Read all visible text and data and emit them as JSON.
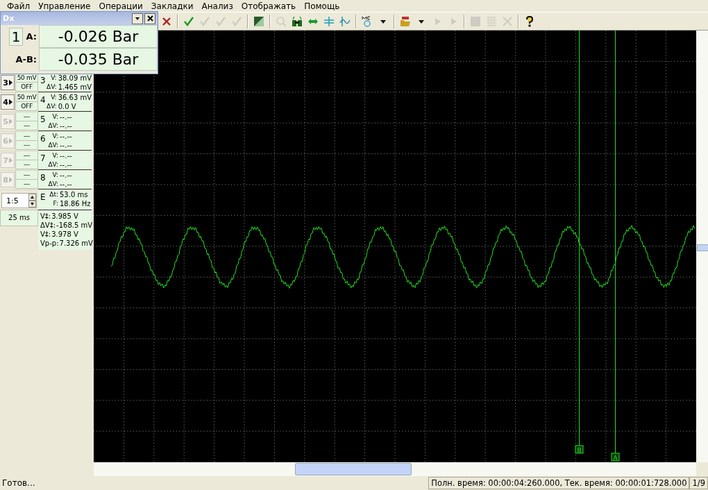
{
  "menu": [
    "Файл",
    "Управление",
    "Операции",
    "Закладки",
    "Анализ",
    "Отображать",
    "Помощь"
  ],
  "toolbar": [
    {
      "kind": "cross",
      "disabled": false
    },
    {
      "kind": "sep"
    },
    {
      "kind": "check",
      "disabled": false
    },
    {
      "kind": "check",
      "disabled": true
    },
    {
      "kind": "check",
      "disabled": true
    },
    {
      "kind": "check",
      "disabled": true
    },
    {
      "kind": "sep"
    },
    {
      "kind": "contrast",
      "disabled": false
    },
    {
      "kind": "sep"
    },
    {
      "kind": "magnifier",
      "disabled": true
    },
    {
      "kind": "binoculars",
      "disabled": false
    },
    {
      "kind": "arrows",
      "disabled": false
    },
    {
      "kind": "cursor",
      "disabled": false
    },
    {
      "kind": "wave",
      "disabled": false
    },
    {
      "kind": "sep"
    },
    {
      "kind": "mem",
      "disabled": false
    },
    {
      "kind": "dropdown",
      "disabled": false
    },
    {
      "kind": "sep"
    },
    {
      "kind": "folder",
      "disabled": false
    },
    {
      "kind": "dropdown",
      "disabled": false
    },
    {
      "kind": "play",
      "disabled": true
    },
    {
      "kind": "play",
      "disabled": true
    },
    {
      "kind": "sep"
    },
    {
      "kind": "square",
      "disabled": true
    },
    {
      "kind": "grid",
      "disabled": true
    },
    {
      "kind": "scissors",
      "disabled": true
    },
    {
      "kind": "sep"
    },
    {
      "kind": "help",
      "disabled": false
    }
  ],
  "dx_window": {
    "title": "Dx",
    "channel": "1",
    "rows": [
      {
        "label": "A:",
        "value": "-0.026 Bar"
      },
      {
        "label": "A-B:",
        "value": "-0.035 Bar"
      }
    ]
  },
  "channels": [
    {
      "button": "3",
      "disabled": false,
      "scale": "50 mV",
      "state": "OFF",
      "number": "3",
      "v_label": "V:",
      "v": "38.09 mV",
      "dv_label": "ΔV:",
      "dv": "1.465 mV"
    },
    {
      "button": "4",
      "disabled": false,
      "scale": "50 mV",
      "state": "OFF",
      "number": "4",
      "v_label": "V:",
      "v": "36.63 mV",
      "dv_label": "ΔV:",
      "dv": "0.0 V"
    },
    {
      "button": "5",
      "disabled": true,
      "scale": "---",
      "state": "---",
      "number": "5",
      "v_label": "V:",
      "v": "--.--",
      "dv_label": "ΔV:",
      "dv": "--.--"
    },
    {
      "button": "6",
      "disabled": true,
      "scale": "---",
      "state": "---",
      "number": "6",
      "v_label": "V:",
      "v": "--.--",
      "dv_label": "ΔV:",
      "dv": "--.--"
    },
    {
      "button": "7",
      "disabled": true,
      "scale": "---",
      "state": "---",
      "number": "7",
      "v_label": "V:",
      "v": "--.--",
      "dv_label": "ΔV:",
      "dv": "--.--"
    },
    {
      "button": "8",
      "disabled": true,
      "scale": "---",
      "state": "---",
      "number": "8",
      "v_label": "V:",
      "v": "--.--",
      "dv_label": "ΔV:",
      "dv": "--.--"
    }
  ],
  "ratio": "1:5",
  "timebase": "25 ms",
  "timing": {
    "e_label": "E",
    "dt_label": "Δt:",
    "dt": "53.0 ms",
    "f_label": "F:",
    "f": "18.86 Hz"
  },
  "voltages": [
    {
      "label": "V‡:",
      "value": "3.985 V"
    },
    {
      "label": "ΔV‡:",
      "value": "-168.5 mV"
    },
    {
      "label": "V‡:",
      "value": "3.978 V"
    },
    {
      "label": "Vp-p:",
      "value": "7.326 mV"
    }
  ],
  "cursors": [
    {
      "label": "B"
    },
    {
      "label": "A"
    }
  ],
  "status_bar": {
    "message": "Готов...",
    "times": "Полн. время: 00:00:04:260.000, Тек. время: 00:00:01:728.000",
    "page": "1/9"
  }
}
